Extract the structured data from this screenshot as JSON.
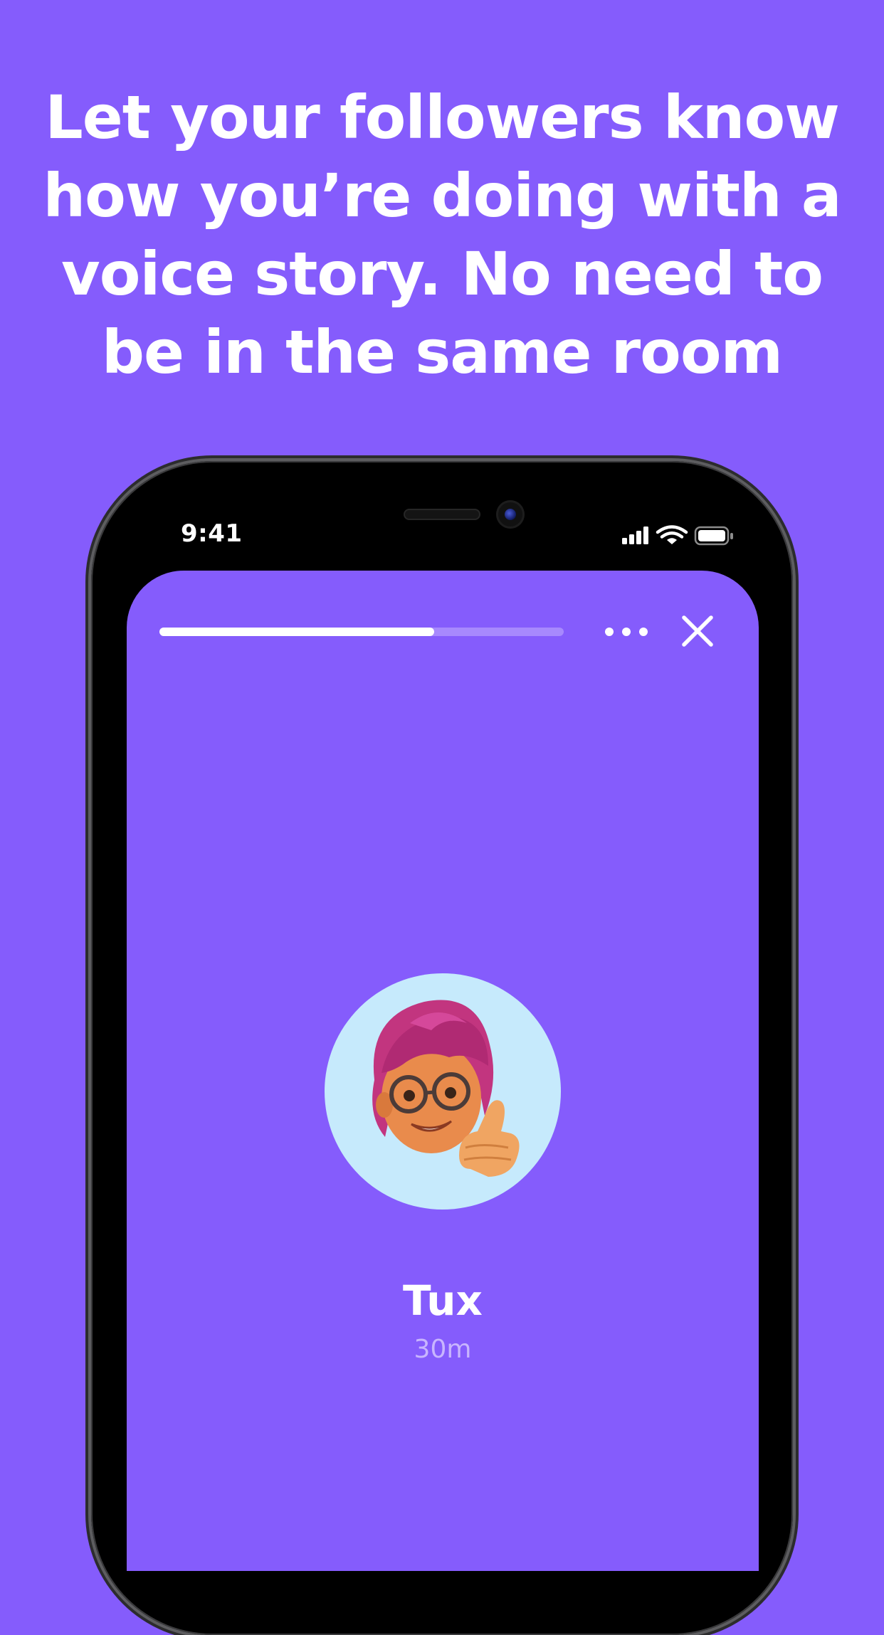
{
  "headline": {
    "line1": "Let your followers know",
    "line2": "how you’re doing with a",
    "line3": "voice story. No need to",
    "line4": "be in the same room"
  },
  "status_bar": {
    "time": "9:41",
    "icons": [
      "cellular-signal-icon",
      "wifi-icon",
      "battery-icon"
    ]
  },
  "story": {
    "progress": 0.68,
    "more_icon": "more-horizontal-icon",
    "close_icon": "close-icon",
    "user": {
      "name": "Tux",
      "time_ago": "30m",
      "avatar": "memoji-avatar"
    }
  },
  "colors": {
    "background": "#855cfc",
    "avatar_bg": "#c6eafc",
    "text": "#ffffff"
  }
}
